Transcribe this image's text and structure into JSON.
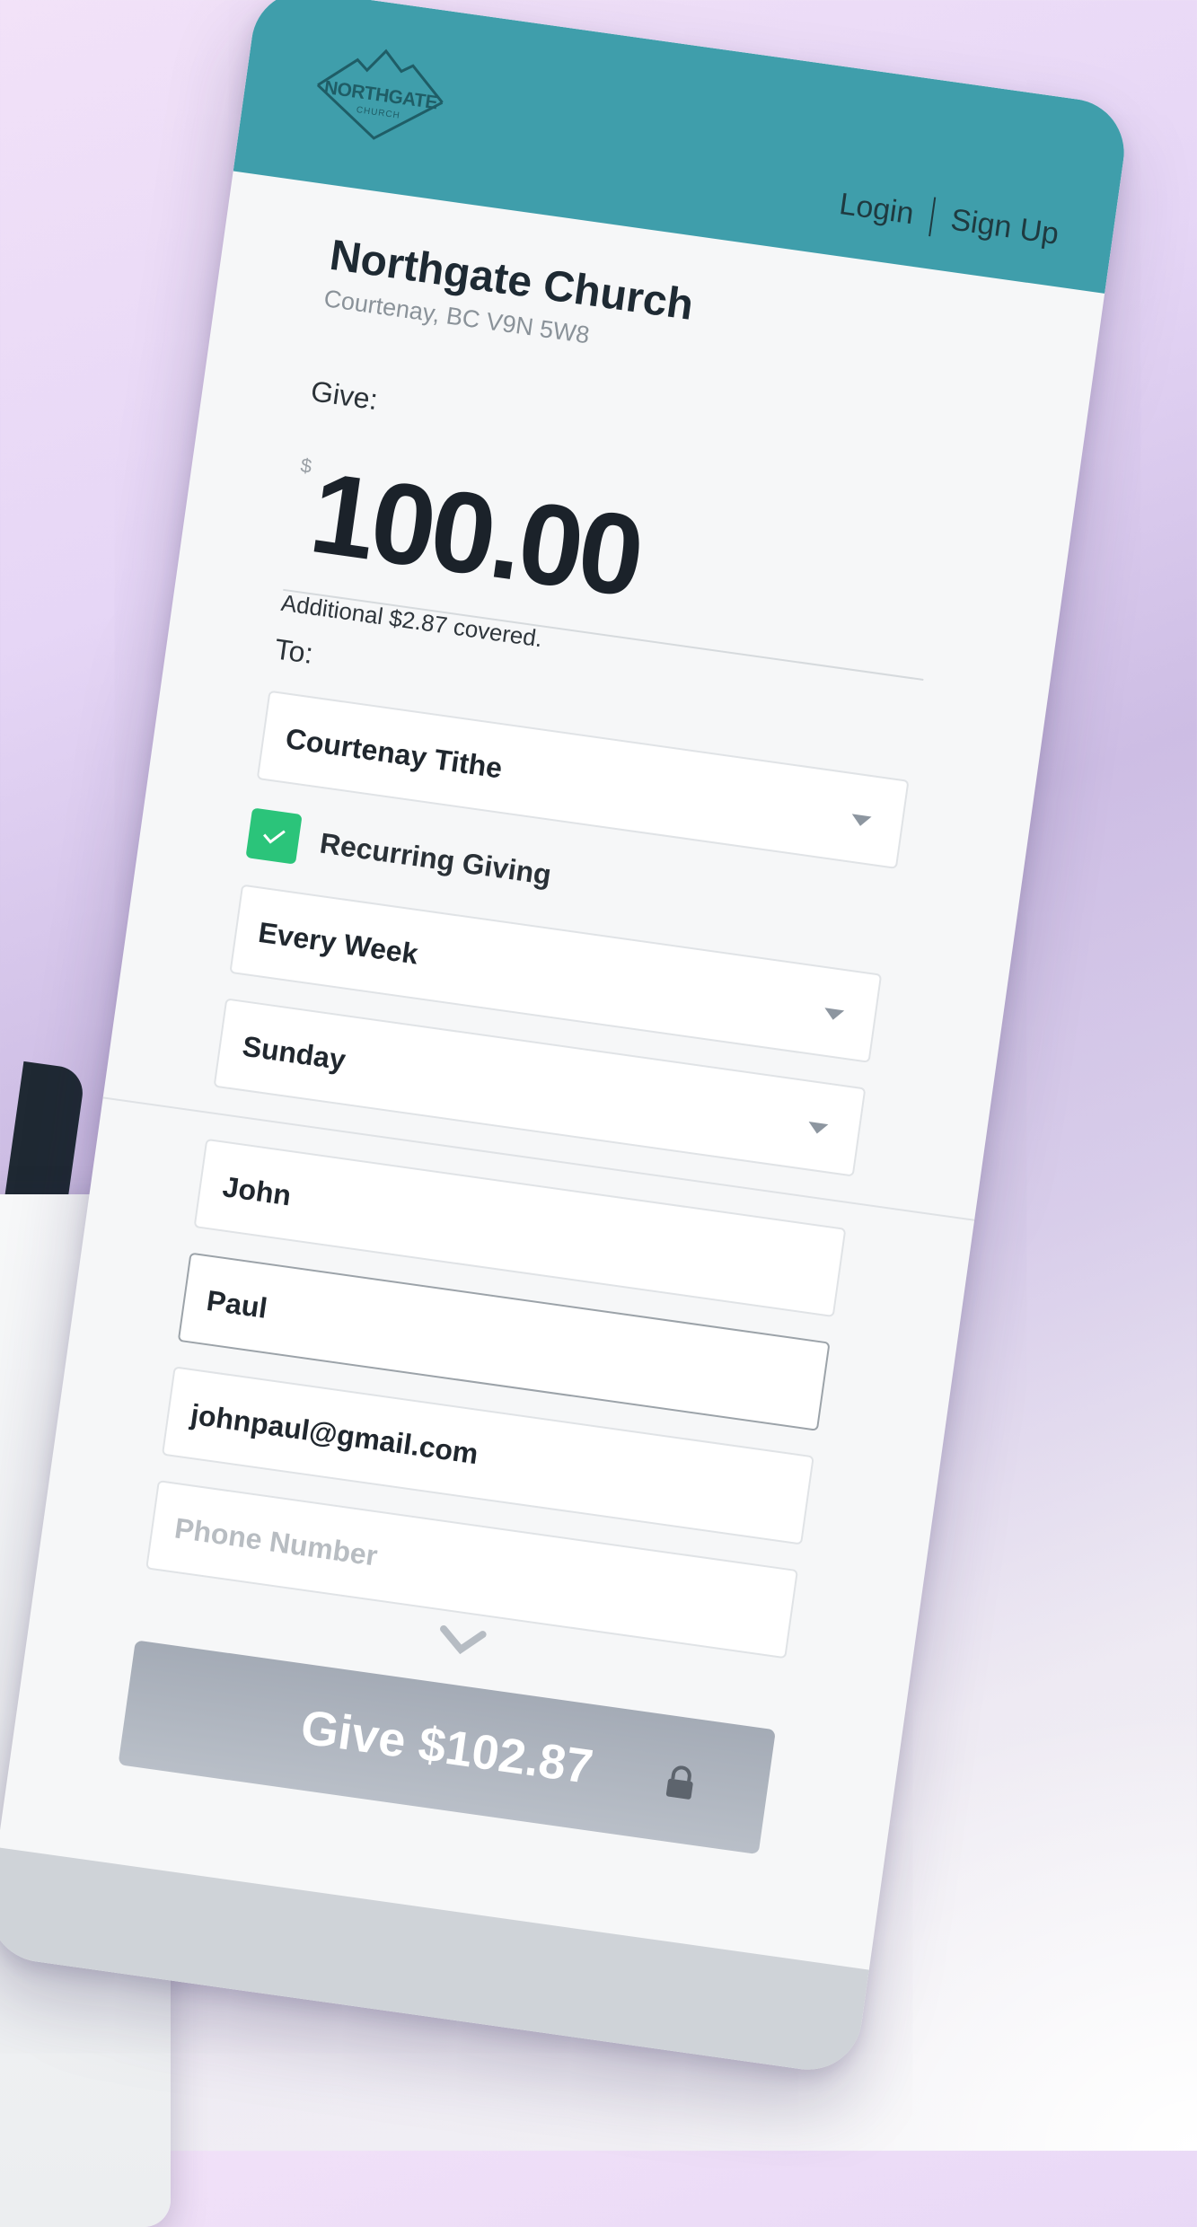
{
  "brand": {
    "logo_name": "NORTHGATE",
    "logo_sub": "CHURCH",
    "accent": "#3f9eab",
    "success": "#2bc47a"
  },
  "header": {
    "login": "Login",
    "signup": "Sign Up"
  },
  "org": {
    "name": "Northgate Church",
    "location": "Courtenay, BC V9N 5W8"
  },
  "give": {
    "label": "Give:",
    "currency": "$",
    "amount": "100.00",
    "covered_note": "Additional $2.87 covered."
  },
  "to": {
    "label": "To:",
    "fund": "Courtenay Tithe"
  },
  "recurring": {
    "checked": true,
    "label": "Recurring Giving",
    "frequency": "Every Week",
    "day": "Sunday"
  },
  "donor": {
    "first_name": "John",
    "last_name": "Paul",
    "email": "johnpaul@gmail.com",
    "phone_placeholder": "Phone Number"
  },
  "submit": {
    "label": "Give $102.87"
  },
  "icons": {
    "dropdown": "chevron-down-icon",
    "check": "check-icon",
    "lock": "lock-icon",
    "scroll": "chevron-down-icon"
  }
}
